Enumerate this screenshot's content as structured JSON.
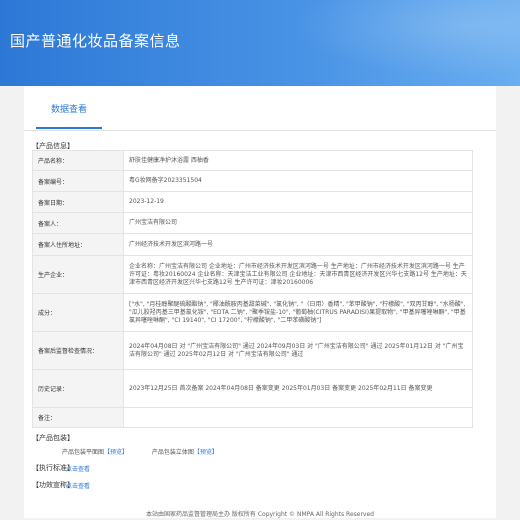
{
  "header": {
    "title": "国产普通化妆品备案信息"
  },
  "tabs": [
    {
      "label": "数据查看"
    }
  ],
  "product_info": {
    "section_label": "【产品信息】",
    "rows": [
      {
        "key": "产品名称：",
        "value": "舒肤佳健康净护沐浴露 西柚香"
      },
      {
        "key": "备案编号：",
        "value": "粤G妆网备字2023351504"
      },
      {
        "key": "备案日期：",
        "value": "2023-12-19"
      },
      {
        "key": "备案人：",
        "value": "广州宝洁有限公司"
      },
      {
        "key": "备案人住所地址：",
        "value": "广州经济技术开发区滨河路一号"
      },
      {
        "key": "生产企业：",
        "value": "企业名称：广州宝洁有限公司 企业地址：广州市经济技术开发区滨河路一号 生产地址：广州市经济技术开发区滨河路一号 生产许可证：粤妆20160024 企业名称：天津宝洁工业有限公司 企业地址：天津市西青区经济开发区兴华七支路12号 生产地址：天津市西青区经济开发区兴华七支路12号 生产许可证：津妆20160006"
      },
      {
        "key": "成分：",
        "value": "[\"水\", \"月桂醇聚醚硫酸酯钠\", \"椰油酰胺丙基甜菜碱\", \"氯化钠\", \"（日用）香精\", \"苯甲酸钠\", \"柠檬酸\", \"双丙甘醇\", \"水杨酸\", \"瓜儿胶羟丙基三甲基氯化铵\", \"EDTA 二钠\", \"聚季铵盐-10\", \"葡萄柚(CITRUS PARADISI)果提取物\", \"甲基异噻唑啉酮\", \"甲基氯异噻唑啉酮\", \"CI 19140\", \"CI 17200\", \"柠檬酸钠\", \"二甲苯磺酸钠\"]"
      },
      {
        "key": "备案后监督检查情况：",
        "value": "2024年04月08日 对 \"广州宝洁有限公司\" 通过 2024年09月03日 对 \"广州宝洁有限公司\" 通过 2025年01月12日 对 \"广州宝洁有限公司\" 通过 2025年02月12日 对 \"广州宝洁有限公司\" 通过"
      },
      {
        "key": "历史记录：",
        "value": "2023年12月25日 首次备案 2024年04月08日 备案变更 2025年01月03日 备案变更 2025年02月11日 备案变更"
      },
      {
        "key": "备注：",
        "value": ""
      }
    ]
  },
  "packaging": {
    "section_label": "【产品包装】",
    "flat_label": "产品包装平面图",
    "flat_link": "【预览】",
    "solid_label": "产品包装立体图",
    "solid_link": "【预览】"
  },
  "standard": {
    "section_label": "【执行标准】",
    "link": "点击查看"
  },
  "efficacy": {
    "section_label": "【功效宣称】",
    "link": "点击查看"
  },
  "footer": {
    "text": "本站由国家药品监督管理局主办 版权所有 Copyright © NMPA All Rights Reserved"
  }
}
